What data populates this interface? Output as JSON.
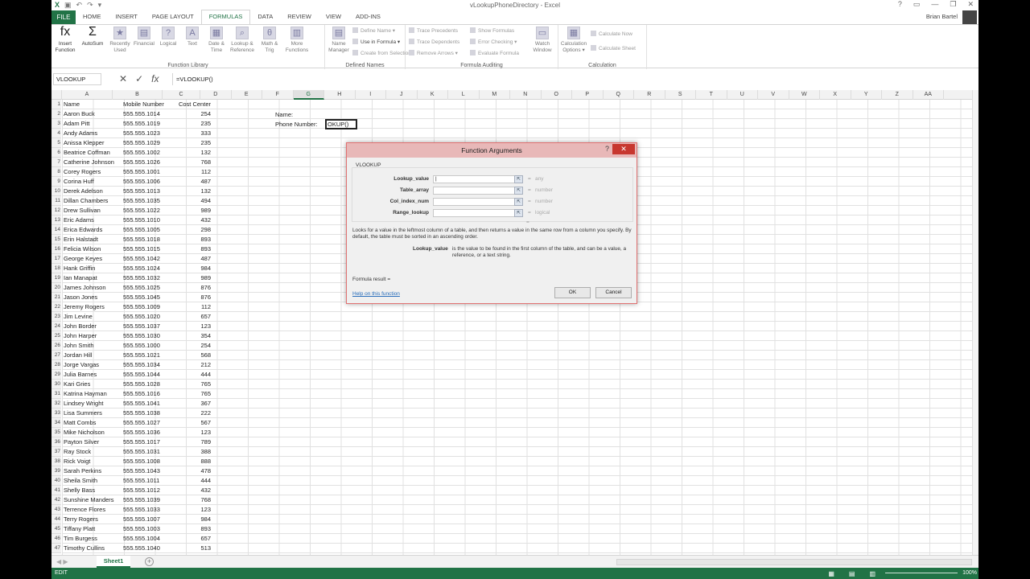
{
  "window": {
    "title": "vLookupPhoneDirectory - Excel",
    "user": "Brian Bartel",
    "controls": [
      "?",
      "▭",
      "—",
      "❐",
      "✕"
    ]
  },
  "tabs": [
    "FILE",
    "HOME",
    "INSERT",
    "PAGE LAYOUT",
    "FORMULAS",
    "DATA",
    "REVIEW",
    "VIEW",
    "ADD-INS"
  ],
  "ribbon": {
    "function_library": {
      "label": "Function Library",
      "buttons": [
        {
          "label": "Insert\nFunction",
          "icon": "fx-icon",
          "glyph": "fx"
        },
        {
          "label": "AutoSum",
          "icon": "sigma-icon",
          "glyph": "Σ"
        },
        {
          "label": "Recently\nUsed",
          "icon": "star-icon",
          "glyph": "★"
        },
        {
          "label": "Financial",
          "icon": "book-icon",
          "glyph": "▤"
        },
        {
          "label": "Logical",
          "icon": "question-book-icon",
          "glyph": "?"
        },
        {
          "label": "Text",
          "icon": "text-book-icon",
          "glyph": "A"
        },
        {
          "label": "Date &\nTime",
          "icon": "calendar-icon",
          "glyph": "▦"
        },
        {
          "label": "Lookup &\nReference",
          "icon": "magnifier-book-icon",
          "glyph": "⌕"
        },
        {
          "label": "Math &\nTrig",
          "icon": "theta-book-icon",
          "glyph": "θ"
        },
        {
          "label": "More\nFunctions",
          "icon": "more-book-icon",
          "glyph": "▥"
        }
      ]
    },
    "defined_names": {
      "label": "Defined Names",
      "name_manager": "Name\nManager",
      "items": [
        "Define Name ▾",
        "Use in Formula ▾",
        "Create from Selection"
      ]
    },
    "formula_auditing": {
      "label": "Formula Auditing",
      "items_left": [
        "Trace Precedents",
        "Trace Dependents",
        "Remove Arrows ▾"
      ],
      "items_right": [
        "Show Formulas",
        "Error Checking ▾",
        "Evaluate Formula"
      ],
      "watch_window": "Watch\nWindow"
    },
    "calculation": {
      "label": "Calculation",
      "options": "Calculation\nOptions ▾",
      "items": [
        "Calculate Now",
        "Calculate Sheet"
      ]
    }
  },
  "formula_bar": {
    "name_box": "VLOOKUP",
    "formula": "=VLOOKUP()"
  },
  "grid": {
    "columns": [
      "A",
      "B",
      "C",
      "D",
      "E",
      "F",
      "G",
      "H",
      "I",
      "J",
      "K",
      "L",
      "M",
      "N",
      "O",
      "P",
      "Q",
      "R",
      "S",
      "T",
      "U",
      "V",
      "W",
      "X",
      "Y",
      "Z",
      "AA"
    ],
    "header": {
      "name": "Name",
      "mobile": "Mobile Number",
      "cost": "Cost Center"
    },
    "rows": [
      {
        "name": "Aaron Buck",
        "mobile": "555.555.1014",
        "cost": "254"
      },
      {
        "name": "Adam Pitt",
        "mobile": "555.555.1019",
        "cost": "235"
      },
      {
        "name": "Andy Adams",
        "mobile": "555.555.1023",
        "cost": "333"
      },
      {
        "name": "Anissa Klepper",
        "mobile": "555.555.1029",
        "cost": "235"
      },
      {
        "name": "Beatrice Coffman",
        "mobile": "555.555.1002",
        "cost": "132"
      },
      {
        "name": "Catherine Johnson",
        "mobile": "555.555.1026",
        "cost": "768"
      },
      {
        "name": "Corey Rogers",
        "mobile": "555.555.1001",
        "cost": "112"
      },
      {
        "name": "Corina Huff",
        "mobile": "555.555.1006",
        "cost": "487"
      },
      {
        "name": "Derek Adelson",
        "mobile": "555.555.1013",
        "cost": "132"
      },
      {
        "name": "Dillan Chambers",
        "mobile": "555.555.1035",
        "cost": "494"
      },
      {
        "name": "Drew Sullivan",
        "mobile": "555.555.1022",
        "cost": "989"
      },
      {
        "name": "Eric Adams",
        "mobile": "555.555.1010",
        "cost": "432"
      },
      {
        "name": "Erica Edwards",
        "mobile": "555.555.1005",
        "cost": "298"
      },
      {
        "name": "Erin Halstadt",
        "mobile": "555.555.1018",
        "cost": "893"
      },
      {
        "name": "Felicia Wilson",
        "mobile": "555.555.1015",
        "cost": "893"
      },
      {
        "name": "George Keyes",
        "mobile": "555.555.1042",
        "cost": "487"
      },
      {
        "name": "Hank Griffin",
        "mobile": "555.555.1024",
        "cost": "984"
      },
      {
        "name": "Ian Manapat",
        "mobile": "555.555.1032",
        "cost": "989"
      },
      {
        "name": "James Johnson",
        "mobile": "555.555.1025",
        "cost": "876"
      },
      {
        "name": "Jason Jones",
        "mobile": "555.555.1045",
        "cost": "876"
      },
      {
        "name": "Jeremy Rogers",
        "mobile": "555.555.1009",
        "cost": "112"
      },
      {
        "name": "Jim Levine",
        "mobile": "555.555.1020",
        "cost": "657"
      },
      {
        "name": "John Border",
        "mobile": "555.555.1037",
        "cost": "123"
      },
      {
        "name": "John Harper",
        "mobile": "555.555.1030",
        "cost": "354"
      },
      {
        "name": "John Smith",
        "mobile": "555.555.1000",
        "cost": "254"
      },
      {
        "name": "Jordan Hill",
        "mobile": "555.555.1021",
        "cost": "568"
      },
      {
        "name": "Jorge Vargas",
        "mobile": "555.555.1034",
        "cost": "212"
      },
      {
        "name": "Julia Barnes",
        "mobile": "555.555.1044",
        "cost": "444"
      },
      {
        "name": "Kari Gries",
        "mobile": "555.555.1028",
        "cost": "765"
      },
      {
        "name": "Katrina Hayman",
        "mobile": "555.555.1016",
        "cost": "765"
      },
      {
        "name": "Lindsey Wright",
        "mobile": "555.555.1041",
        "cost": "367"
      },
      {
        "name": "Lisa Summers",
        "mobile": "555.555.1038",
        "cost": "222"
      },
      {
        "name": "Matt Combs",
        "mobile": "555.555.1027",
        "cost": "567"
      },
      {
        "name": "Mike Nicholson",
        "mobile": "555.555.1036",
        "cost": "123"
      },
      {
        "name": "Payton Silver",
        "mobile": "555.555.1017",
        "cost": "789"
      },
      {
        "name": "Ray Stock",
        "mobile": "555.555.1031",
        "cost": "388"
      },
      {
        "name": "Rick Voigt",
        "mobile": "555.555.1008",
        "cost": "888"
      },
      {
        "name": "Sarah Perkins",
        "mobile": "555.555.1043",
        "cost": "478"
      },
      {
        "name": "Sheila Smith",
        "mobile": "555.555.1011",
        "cost": "444"
      },
      {
        "name": "Shelly Bass",
        "mobile": "555.555.1012",
        "cost": "432"
      },
      {
        "name": "Sunshine Manders",
        "mobile": "555.555.1039",
        "cost": "768"
      },
      {
        "name": "Terrence Flores",
        "mobile": "555.555.1033",
        "cost": "123"
      },
      {
        "name": "Terry Rogers",
        "mobile": "555.555.1007",
        "cost": "984"
      },
      {
        "name": "Tiffany Platt",
        "mobile": "555.555.1003",
        "cost": "893"
      },
      {
        "name": "Tim Burgess",
        "mobile": "555.555.1004",
        "cost": "657"
      },
      {
        "name": "Timothy Cullins",
        "mobile": "555.555.1040",
        "cost": "513"
      }
    ],
    "lookup_labels": {
      "name": "Name:",
      "phone": "Phone Number:"
    },
    "edit_cell_value": "OKUP()"
  },
  "sheet_tab": "Sheet1",
  "status": {
    "mode": "EDIT",
    "zoom": "100%"
  },
  "dialog": {
    "title": "Function Arguments",
    "help_glyph": "?",
    "close_glyph": "✕",
    "function_name": "VLOOKUP",
    "args": [
      {
        "label": "Lookup_value",
        "value": "|",
        "type": "any"
      },
      {
        "label": "Table_array",
        "value": "",
        "type": "number"
      },
      {
        "label": "Col_index_num",
        "value": "",
        "type": "number"
      },
      {
        "label": "Range_lookup",
        "value": "",
        "type": "logical"
      }
    ],
    "equals": "=",
    "description": "Looks for a value in the leftmost column of a table, and then returns a value in the same row from a column you specify. By default, the table must be sorted in an ascending order.",
    "arg_desc_label": "Lookup_value",
    "arg_desc": "is the value to be found in the first column of the table, and can be a value, a reference, or a text string.",
    "result_label": "Formula result =",
    "help_link": "Help on this function",
    "ok": "OK",
    "cancel": "Cancel"
  },
  "colors": {
    "excel_green": "#217346",
    "close_red": "#c7372f",
    "link_blue": "#2a6ebb"
  }
}
